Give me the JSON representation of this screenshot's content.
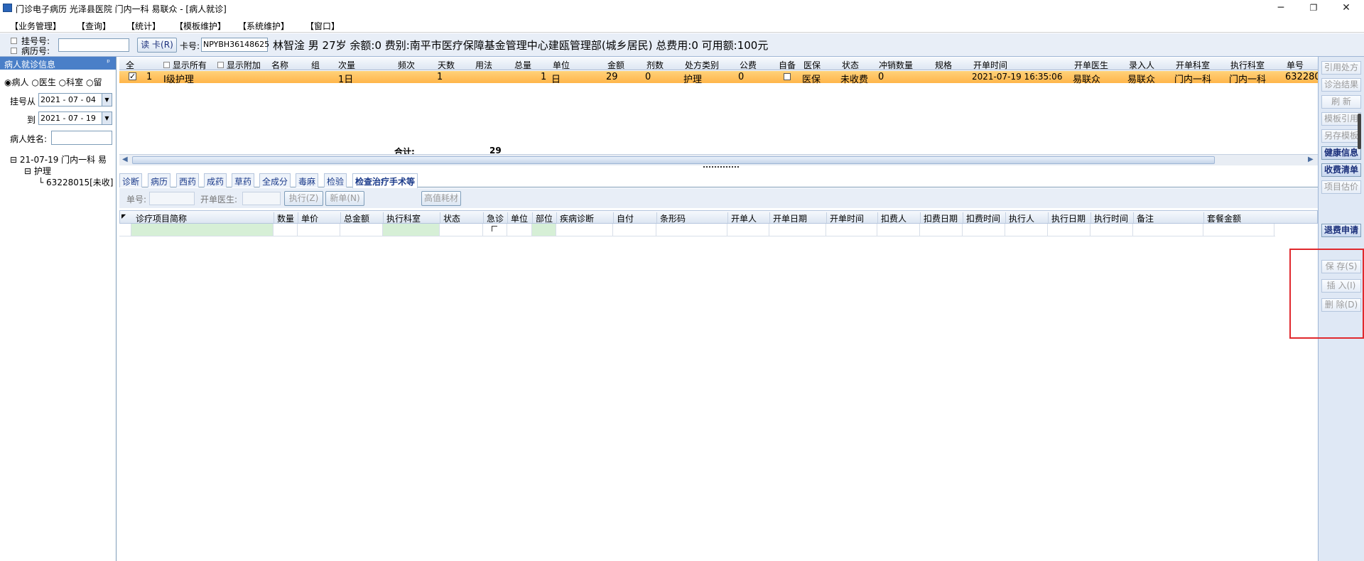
{
  "window": {
    "title": "门诊电子病历  光泽县医院  门内一科  易联众 - [病人就诊]",
    "minimize": "─",
    "restore": "❐",
    "close": "✕"
  },
  "menu": [
    "【业务管理】",
    "【查询】",
    "【统计】",
    "【模板维护】",
    "【系统维护】",
    "【窗口】"
  ],
  "infobar": {
    "reg_no_label": "挂号号:",
    "case_no_label": "病历号:",
    "read_card_btn": "读 卡(R)",
    "card_no_label": "卡号:",
    "card_no_value": "NPYBH36148625",
    "patient_summary": "林智淦  男  27岁  余额:0  费别:南平市医疗保障基金管理中心建瓯管理部(城乡居民)  总费用:0  可用额:100元"
  },
  "left": {
    "panel_title": "病人就诊信息",
    "pin": "ᵖ",
    "radios": [
      "病人",
      "医生",
      "科室",
      "留"
    ],
    "date_from_label": "挂号从",
    "date_from": "2021 - 07 - 04",
    "date_to_label": "到",
    "date_to": "2021 - 07 - 19",
    "name_label": "病人姓名:",
    "tree": {
      "root": "21-07-19  门内一科  易",
      "child": "护理",
      "leaf": "63228015[未收]"
    }
  },
  "grid1": {
    "headers": [
      "全",
      "显示所有",
      "显示附加",
      "名称",
      "组",
      "次量",
      "频次",
      "天数",
      "用法",
      "总量",
      "单位",
      "金额",
      "剂数",
      "处方类别",
      "公费",
      "自备",
      "医保",
      "状态",
      "冲销数量",
      "规格",
      "开单时间",
      "开单医生",
      "录入人",
      "开单科室",
      "执行科室",
      "单号"
    ],
    "row": {
      "index": "1",
      "name": "Ⅰ级护理",
      "dose": "1日",
      "days": "1",
      "total": "1",
      "unit": "日",
      "amount": "29",
      "doses": "0",
      "rx_type": "护理",
      "public_fee": "0",
      "insurance": "医保",
      "status": "未收费",
      "reverse_qty": "0",
      "order_time": "2021-07-19 16:35:06",
      "doctor": "易联众",
      "entered_by": "易联众",
      "order_dept": "门内一科",
      "exec_dept": "门内一科",
      "order_no": "632280"
    },
    "total_label": "合计:",
    "total_value": "29"
  },
  "tabs": [
    "诊断",
    "病历",
    "西药",
    "成药",
    "草药",
    "全成分",
    "毒麻",
    "检验",
    "检查治疗手术等"
  ],
  "toolbar2": {
    "order_no_label": "单号:",
    "doctor_label": "开单医生:",
    "execute_btn": "执行(Z)",
    "new_btn": "新单(N)",
    "high_value_btn": "高值耗材"
  },
  "grid2": {
    "headers": [
      "诊疗项目简称",
      "数量",
      "单价",
      "总金额",
      "执行科室",
      "状态",
      "急诊",
      "单位",
      "部位",
      "疾病诊断",
      "自付",
      "条形码",
      "开单人",
      "开单日期",
      "开单时间",
      "扣费人",
      "扣费日期",
      "扣费时间",
      "执行人",
      "执行日期",
      "执行时间",
      "备注",
      "套餐金额"
    ]
  },
  "right": {
    "buttons": [
      "引用处方",
      "诊治结果",
      "刷  新",
      "模板引用",
      "另存模板",
      "健康信息",
      "收费清单",
      "项目估价",
      "退费申请",
      "保  存(S)",
      "插  入(I)",
      "删  除(D)"
    ]
  },
  "colors": {
    "accent": "#4a7fc8",
    "row_highlight": "#ffc060",
    "highlight_box": "#e0282d"
  }
}
